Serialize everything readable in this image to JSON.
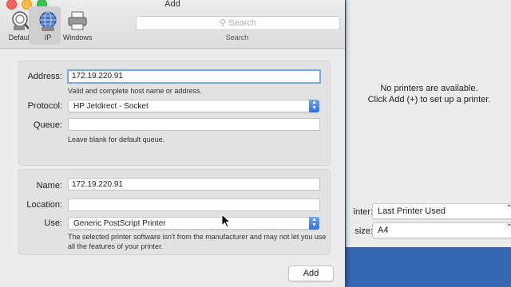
{
  "window": {
    "title": "Add"
  },
  "toolbar": {
    "default_label": "Default",
    "ip_label": "IP",
    "windows_label": "Windows",
    "search_placeholder": "Search",
    "search_label": "Search"
  },
  "connection": {
    "address_label": "Address:",
    "address_value": "172.19.220.91",
    "address_hint": "Valid and complete host name or address.",
    "protocol_label": "Protocol:",
    "protocol_value": "HP Jetdirect - Socket",
    "queue_label": "Queue:",
    "queue_value": "",
    "queue_hint": "Leave blank for default queue."
  },
  "printer": {
    "name_label": "Name:",
    "name_value": "172.19.220.91",
    "location_label": "Location:",
    "location_value": "",
    "use_label": "Use:",
    "use_value": "Generic PostScript Printer",
    "use_hint": "The selected printer software isn't from the manufacturer and may not let you use all the features of your printer."
  },
  "add_button": "Add",
  "background_window": {
    "empty_line1": "No printers are available.",
    "empty_line2": "Click Add (+) to set up a printer.",
    "printer_label": "inter:",
    "printer_value": "Last Printer Used",
    "size_label": "size:",
    "size_value": "A4"
  },
  "colors": {
    "accent": "#2a72e6",
    "desktop": "#2e5aa6"
  }
}
